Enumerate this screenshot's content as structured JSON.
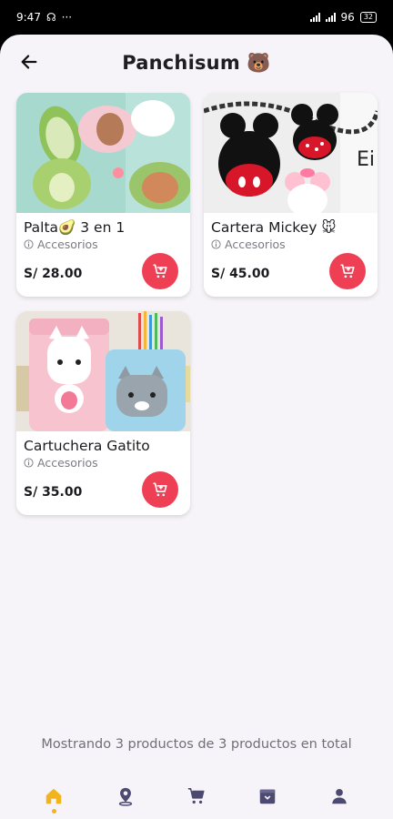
{
  "status_bar": {
    "time": "9:47",
    "network_label": "96",
    "battery_label": "32"
  },
  "header": {
    "title": "Panchisum 🐻",
    "back_icon": "arrow-left-icon"
  },
  "products": [
    {
      "name": "Palta🥑 3 en 1",
      "category": "Accesorios",
      "price": "S/ 28.00",
      "image": "avocado-mirrors-image"
    },
    {
      "name": "Cartera Mickey 🐭",
      "category": "Accesorios",
      "price": "S/ 45.00",
      "image": "mickey-purse-image"
    },
    {
      "name": "Cartuchera Gatito",
      "category": "Accesorios",
      "price": "S/ 35.00",
      "image": "cat-pencil-case-image"
    }
  ],
  "summary": "Mostrando 3 productos de 3 productos en total",
  "nav": [
    {
      "name": "home",
      "icon": "home-icon",
      "active": true
    },
    {
      "name": "location",
      "icon": "location-pin-icon",
      "active": false
    },
    {
      "name": "cart",
      "icon": "cart-icon",
      "active": false
    },
    {
      "name": "archive",
      "icon": "archive-box-icon",
      "active": false
    },
    {
      "name": "profile",
      "icon": "person-icon",
      "active": false
    }
  ],
  "colors": {
    "accent_red": "#ef3f55",
    "nav_active": "#f2b41b",
    "nav_inactive": "#4d4a72",
    "background": "#f6f4f8"
  }
}
